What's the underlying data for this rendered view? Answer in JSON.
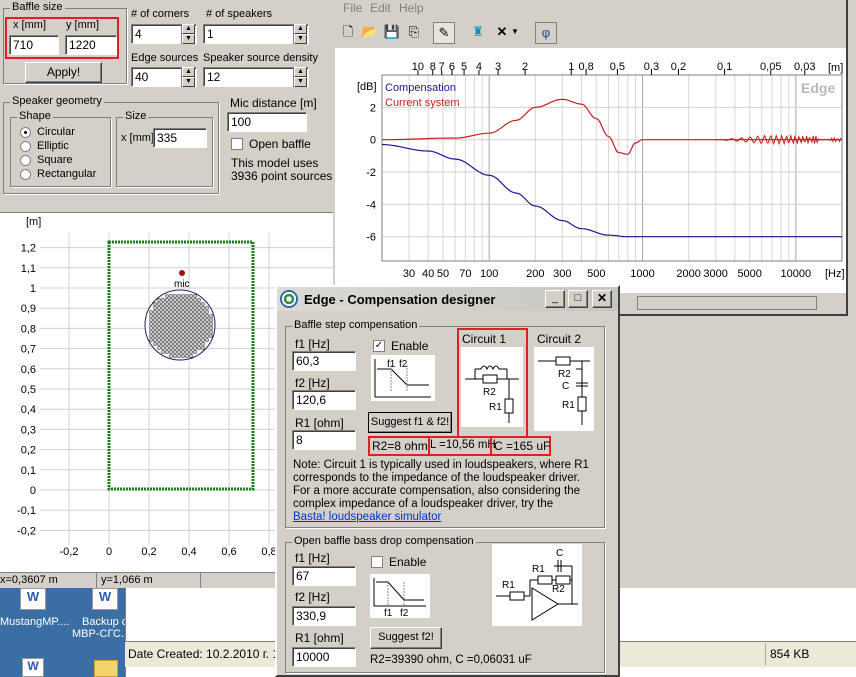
{
  "baffle": {
    "title": "Baffle size",
    "x_label": "x [mm]",
    "y_label": "y [mm]",
    "x_value": "710",
    "y_value": "1220",
    "apply": "Apply!",
    "corners_label": "# of corners",
    "corners_value": "4",
    "speakers_label": "# of speakers",
    "speakers_value": "1",
    "edge_label": "Edge sources",
    "edge_value": "40",
    "density_label": "Speaker source density",
    "density_value": "12"
  },
  "geometry": {
    "title": "Speaker geometry",
    "shape_title": "Shape",
    "shapes": [
      "Circular",
      "Elliptic",
      "Square",
      "Rectangular"
    ],
    "size_title": "Size",
    "size_label": "x [mm]",
    "size_value": "335",
    "mic_label": "Mic distance [m]",
    "mic_value": "100",
    "open_baffle": "Open baffle",
    "info1": "This model uses",
    "info2": "3936 point sources"
  },
  "baffle_plot": {
    "y_unit": "[m]",
    "yticks": [
      "1,2",
      "1,1",
      "1",
      "0,9",
      "0,8",
      "0,7",
      "0,6",
      "0,5",
      "0,4",
      "0,3",
      "0,2",
      "0,1",
      "0",
      "-0,1",
      "-0,2"
    ],
    "xticks": [
      "-0,2",
      "0",
      "0,2",
      "0,4",
      "0,6",
      "0,8"
    ],
    "mic": "mic",
    "status_x": "x=0,3607 m",
    "status_y": "y=1,066 m"
  },
  "menu": {
    "file": "File",
    "edit": "Edit",
    "help": "Help"
  },
  "toolbar": {
    "phi": "φ"
  },
  "response": {
    "top_ticks": [
      "10",
      "8",
      "7",
      "6",
      "5",
      "4",
      "3",
      "2",
      "1",
      "0,8",
      "0,5",
      "0,3",
      "0,2",
      "0,1",
      "0,05",
      "0,03"
    ],
    "top_unit": "[m]",
    "y_unit": "[dB]",
    "yticks": [
      "2",
      "0",
      "-2",
      "-4",
      "-6"
    ],
    "xticks": [
      "30",
      "40",
      "50",
      "70",
      "100",
      "200",
      "300",
      "500",
      "1000",
      "2000",
      "3000",
      "5000",
      "10000"
    ],
    "x_unit": "[Hz]",
    "legend_compensation": "Compensation",
    "legend_current": "Current system",
    "watermark": "Edge",
    "colors": {
      "compensation": "#1a1a8c",
      "current": "#c81e1e"
    }
  },
  "chart_data": {
    "type": "line",
    "xlabel": "[Hz]",
    "ylabel": "[dB]",
    "xscale": "log",
    "xlim": [
      20,
      20000
    ],
    "ylim": [
      -7.5,
      4
    ],
    "series": [
      {
        "name": "Compensation",
        "x": [
          20,
          40,
          60,
          100,
          150,
          200,
          300,
          400,
          600,
          800,
          1000,
          2000,
          5000,
          20000
        ],
        "y": [
          -0.3,
          -0.7,
          -1.2,
          -2.2,
          -3.3,
          -4.1,
          -5.0,
          -5.5,
          -5.9,
          -6.0,
          -6.0,
          -6.0,
          -6.0,
          -6.0
        ]
      },
      {
        "name": "Current system",
        "x": [
          20,
          60,
          100,
          150,
          200,
          300,
          400,
          500,
          600,
          700,
          800,
          900,
          1000,
          1500,
          2000,
          5000,
          20000
        ],
        "y": [
          0,
          0.1,
          0.4,
          1.2,
          2.0,
          2.5,
          2.2,
          1.3,
          0.2,
          -0.8,
          -0.9,
          -0.2,
          0.0,
          0.0,
          0.0,
          0.0,
          0.0
        ]
      }
    ]
  },
  "dialog": {
    "title": "Edge - Compensation designer",
    "step_group": "Baffle step compensation",
    "f1_label": "f1 [Hz]",
    "f1_value": "60,3",
    "f2_label": "f2 [Hz]",
    "f2_value": "120,6",
    "r1_label": "R1 [ohm]",
    "r1_value": "8",
    "enable": "Enable",
    "suggest": "Suggest f1 & f2!",
    "circuit1": "Circuit 1",
    "circuit2": "Circuit 2",
    "res_r2": "R2=8 ohm,",
    "res_l": "L =10,56 mH",
    "res_c": "C =165 uF",
    "note": "Note: Circuit 1 is typically used in loudspeakers, where R1 corresponds to the impedance of the loudspeaker driver. For a more accurate compensation, also considering the complex impedance of a loudspeaker driver, try the",
    "link": "Basta! loudspeaker simulator",
    "open_group": "Open baffle bass drop compensation",
    "of1_label": "f1 [Hz]",
    "of1_value": "67",
    "of2_label": "f2 [Hz]",
    "of2_value": "330,9",
    "or1_label": "R1 [ohm]",
    "or1_value": "10000",
    "suggest2": "Suggest f2!",
    "result2": "R2=39390 ohm, C =0,06031 uF",
    "sketch_f1": "f1",
    "sketch_f2": "f2",
    "c_r1": "R1",
    "c_r2": "R2",
    "c_c": "C"
  },
  "desktop": {
    "icon1": "MustangMP....",
    "icon2_line1": "Backup c",
    "icon2_line2": "МВР-СГС....",
    "date_created": "Date Created: 10.2.2010 г. 1",
    "size": "854 KB"
  }
}
